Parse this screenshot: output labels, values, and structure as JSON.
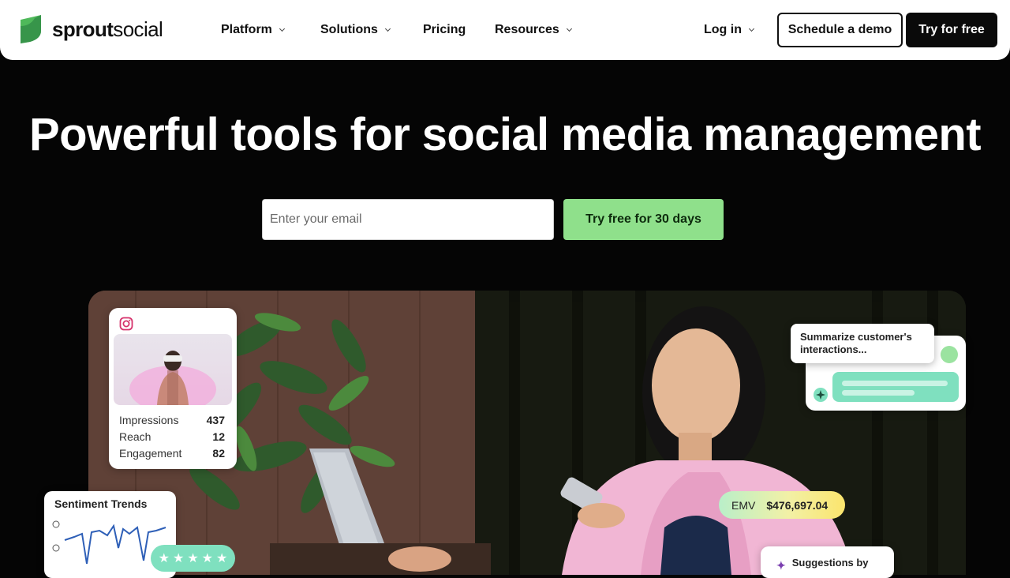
{
  "header": {
    "logo_bold": "sprout",
    "logo_light": "social",
    "nav": [
      {
        "label": "Platform",
        "has_dropdown": true
      },
      {
        "label": "Solutions",
        "has_dropdown": true
      },
      {
        "label": "Pricing",
        "has_dropdown": false
      },
      {
        "label": "Resources",
        "has_dropdown": true
      }
    ],
    "login_label": "Log in",
    "demo_label": "Schedule a demo",
    "try_label": "Try for free"
  },
  "hero": {
    "title": "Powerful tools for social media management",
    "email_placeholder": "Enter your email",
    "email_value": "",
    "cta_label": "Try free for 30 days"
  },
  "cards": {
    "instagram": {
      "metrics": [
        {
          "label": "Impressions",
          "value": "437"
        },
        {
          "label": "Reach",
          "value": "12"
        },
        {
          "label": "Engagement",
          "value": "82"
        }
      ]
    },
    "sentiment": {
      "title": "Sentiment Trends",
      "rating_stars": 5
    },
    "summarize": {
      "text": "Summarize customer's interactions..."
    },
    "emv": {
      "label": "EMV",
      "value": "$476,697.04"
    },
    "suggestions": {
      "text": "Suggestions by"
    }
  },
  "colors": {
    "brand_green": "#59cb59",
    "cta_green": "#8fe08b",
    "hero_bg": "#050505",
    "mint": "#7fe0bf"
  },
  "icons": [
    "sprout-logo-icon",
    "chevron-down-icon",
    "instagram-icon",
    "sparkle-icon",
    "star-icon",
    "smiley-icon"
  ]
}
